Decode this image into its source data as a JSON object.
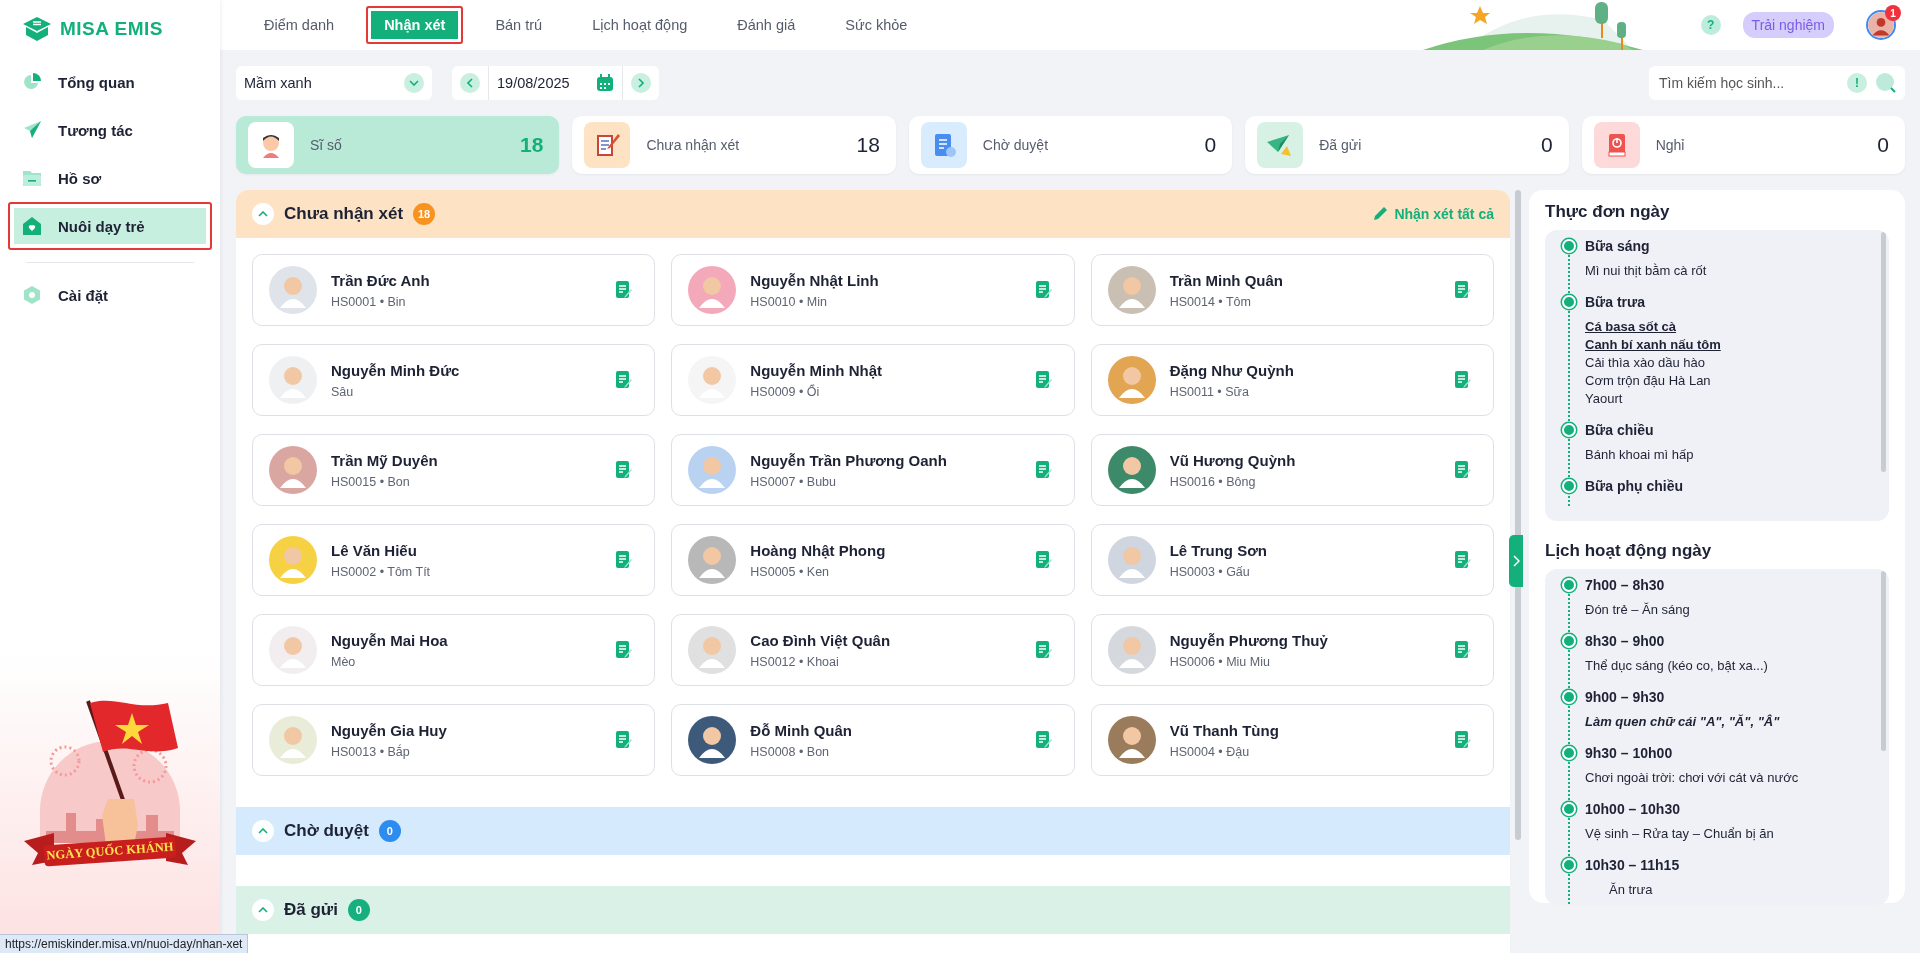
{
  "sidebar": {
    "logo": "MISA EMIS",
    "items": [
      {
        "label": "Tổng quan",
        "selected": false,
        "highlighted": false
      },
      {
        "label": "Tương tác",
        "selected": false,
        "highlighted": false
      },
      {
        "label": "Hồ sơ",
        "selected": false,
        "highlighted": false
      },
      {
        "label": "Nuôi dạy trẻ",
        "selected": true,
        "highlighted": true
      },
      {
        "label": "Cài đặt",
        "selected": false,
        "highlighted": false
      }
    ],
    "banner": {
      "text": "NGÀY QUỐC KHÁNH"
    }
  },
  "tabs": [
    {
      "label": "Điểm danh",
      "selected": false,
      "highlighted": false
    },
    {
      "label": "Nhận xét",
      "selected": true,
      "highlighted": true
    },
    {
      "label": "Bán trú",
      "selected": false,
      "highlighted": false
    },
    {
      "label": "Lịch hoạt động",
      "selected": false,
      "highlighted": false
    },
    {
      "label": "Đánh giá",
      "selected": false,
      "highlighted": false
    },
    {
      "label": "Sức khỏe",
      "selected": false,
      "highlighted": false
    }
  ],
  "header": {
    "help": "?",
    "trial_button": "Trải nghiệm",
    "notification_count": "1"
  },
  "filters": {
    "class_select": "Mầm xanh",
    "date": "19/08/2025",
    "search": {
      "placeholder": "Tìm kiếm học sinh..."
    },
    "info": "!"
  },
  "stats": [
    {
      "kind": "total",
      "label": "Sĩ số",
      "value": "18",
      "selected": true
    },
    {
      "kind": "pending",
      "label": "Chưa nhận xét",
      "value": "18",
      "selected": false
    },
    {
      "kind": "review",
      "label": "Chờ duyệt",
      "value": "0",
      "selected": false
    },
    {
      "kind": "sent",
      "label": "Đã gửi",
      "value": "0",
      "selected": false
    },
    {
      "kind": "absent",
      "label": "Nghỉ",
      "value": "0",
      "selected": false
    }
  ],
  "sections": [
    {
      "kind": "pending",
      "title": "Chưa nhận xét",
      "count": "18",
      "expanded": true,
      "action": "Nhận xét tất cả",
      "students": [
        {
          "name": "Trần Đức Anh",
          "code": "HS0001",
          "separator": "•",
          "nickname": "Bin"
        },
        {
          "name": "Nguyễn Nhật Linh",
          "code": "HS0010",
          "separator": "•",
          "nickname": "Min"
        },
        {
          "name": "Trần Minh Quân",
          "code": "HS0014",
          "separator": "•",
          "nickname": "Tôm"
        },
        {
          "name": "Nguyễn Minh Đức",
          "nickname": "Sâu"
        },
        {
          "name": "Nguyễn Minh Nhật",
          "code": "HS0009",
          "separator": "•",
          "nickname": "Ổi"
        },
        {
          "name": "Đặng Như Quỳnh",
          "code": "HS0011",
          "separator": "•",
          "nickname": "Sữa"
        },
        {
          "name": "Trần Mỹ Duyên",
          "code": "HS0015",
          "separator": "•",
          "nickname": "Bon"
        },
        {
          "name": "Nguyễn Trần Phương Oanh",
          "code": "HS0007",
          "separator": "•",
          "nickname": "Bubu"
        },
        {
          "name": "Vũ Hương Quỳnh",
          "code": "HS0016",
          "separator": "•",
          "nickname": "Bông"
        },
        {
          "name": "Lê Văn Hiếu",
          "code": "HS0002",
          "separator": "•",
          "nickname": "Tôm Tít"
        },
        {
          "name": "Hoàng Nhật Phong",
          "code": "HS0005",
          "separator": "•",
          "nickname": "Ken"
        },
        {
          "name": "Lê Trung Sơn",
          "code": "HS0003",
          "separator": "•",
          "nickname": "Gấu"
        },
        {
          "name": "Nguyễn Mai Hoa",
          "nickname": "Mèo"
        },
        {
          "name": "Cao Đình Việt Quân",
          "code": "HS0012",
          "separator": "•",
          "nickname": "Khoai"
        },
        {
          "name": "Nguyễn Phương Thuỷ",
          "code": "HS0006",
          "separator": "•",
          "nickname": "Miu Miu"
        },
        {
          "name": "Nguyễn Gia Huy",
          "code": "HS0013",
          "separator": "•",
          "nickname": "Bắp"
        },
        {
          "name": "Đỗ Minh Quân",
          "code": "HS0008",
          "separator": "•",
          "nickname": "Bon"
        },
        {
          "name": "Vũ Thanh Tùng",
          "code": "HS0004",
          "separator": "•",
          "nickname": "Đậu"
        }
      ]
    },
    {
      "kind": "review",
      "title": "Chờ duyệt",
      "count": "0",
      "expanded": true
    },
    {
      "kind": "sent",
      "title": "Đã gửi",
      "count": "0",
      "expanded": true
    }
  ],
  "day_panel": {
    "menu": {
      "title": "Thực đơn ngày",
      "meals": [
        {
          "name": "Bữa sáng",
          "dishes": [
            {
              "text": "Mì nui thịt bằm cà rốt",
              "emphasized": false
            }
          ]
        },
        {
          "name": "Bữa trưa",
          "dishes": [
            {
              "text": "Cá basa sốt cà",
              "emphasized": true
            },
            {
              "text": "Canh bí xanh nấu tôm",
              "emphasized": true
            },
            {
              "text": "Cải thìa xào dầu hào",
              "emphasized": false
            },
            {
              "text": "Cơm trộn đậu Hà Lan",
              "emphasized": false
            },
            {
              "text": "Yaourt",
              "emphasized": false
            }
          ]
        },
        {
          "name": "Bữa chiều",
          "dishes": [
            {
              "text": "Bánh khoai mì hấp",
              "emphasized": false
            }
          ]
        },
        {
          "name": "Bữa phụ chiều"
        }
      ]
    },
    "schedule": {
      "title": "Lịch hoạt động ngày",
      "items": [
        {
          "time": "7h00 – 8h30",
          "activity": "Đón trẻ – Ăn sáng",
          "emphasized": false
        },
        {
          "time": "8h30 – 9h00",
          "activity": "Thể dục sáng (kéo co, bật xa...)",
          "emphasized": false
        },
        {
          "time": "9h00 – 9h30",
          "activity": "Làm quen chữ cái \"A\", \"Ă\", \"Â\"",
          "emphasized": true
        },
        {
          "time": "9h30 – 10h00",
          "activity": "Chơi ngoài trời: chơi với cát và nước",
          "emphasized": false
        },
        {
          "time": "10h00 – 10h30",
          "activity": "Vệ sinh – Rửa tay – Chuẩn bị ăn",
          "emphasized": false
        },
        {
          "time": "10h30 – 11h15",
          "activity": "Ăn trưa",
          "emphasized": false
        }
      ]
    }
  },
  "status_url": "https://emiskinder.misa.vn/nuoi-day/nhan-xet"
}
